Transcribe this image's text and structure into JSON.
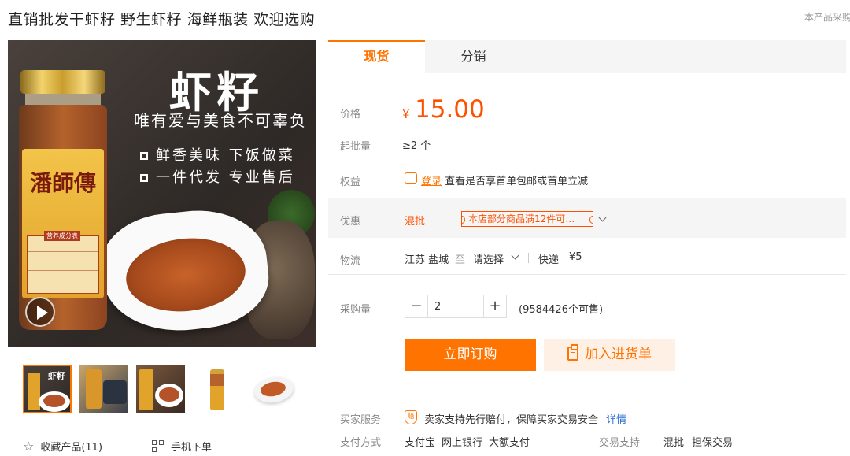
{
  "product": {
    "title": "直销批发干虾籽 野生虾籽 海鲜瓶装 欢迎选购",
    "top_note": "本产品采购"
  },
  "main_image": {
    "headline": "虾籽",
    "slogan": "唯有爱与美食不可辜负",
    "features": [
      "鲜香美味 下饭做菜",
      "一件代发 专业售后"
    ],
    "brand": "潘師傳",
    "nutrition_title": "营养成分表"
  },
  "thumbs": [
    {
      "label": "虾籽"
    },
    {
      "label": ""
    },
    {
      "label": ""
    },
    {
      "label": ""
    },
    {
      "label": ""
    }
  ],
  "actions": {
    "favorite_label": "收藏产品(11)",
    "mobile_label": "手机下单"
  },
  "tabs": {
    "spot": "现货",
    "distribution": "分销"
  },
  "info": {
    "price_label": "价格",
    "currency": "¥",
    "price": "15.00",
    "moq_label": "起批量",
    "moq_value": "≥2 个",
    "perks_label": "权益",
    "login_link": "登录",
    "perks_text": "查看是否享首单包邮或首单立减",
    "promo_label": "优惠",
    "mix_tag": "混批",
    "coupon_text": "本店部分商品满12件可…",
    "logistics_label": "物流",
    "origin": "江苏 盐城",
    "to": "至",
    "destination": "请选择",
    "shipping_method": "快递",
    "shipping_fee": "¥5"
  },
  "purchase": {
    "qty_label": "采购量",
    "qty_value": "2",
    "available": "(9584426个可售)",
    "buy_now": "立即订购",
    "add_to_list": "加入进货单"
  },
  "service": {
    "buyer_label": "买家服务",
    "shield_glyph": "赔",
    "buyer_text": "卖家支持先行赔付，保障买家交易安全",
    "detail_link": "详情",
    "payment_label": "支付方式",
    "payment_methods": [
      "支付宝",
      "网上银行",
      "大额支付"
    ],
    "trade_label": "交易支持",
    "trade_methods": [
      "混批",
      "担保交易"
    ]
  },
  "colors": {
    "accent": "#ff7300",
    "price": "#ff5000",
    "link": "#2e6fd4"
  }
}
